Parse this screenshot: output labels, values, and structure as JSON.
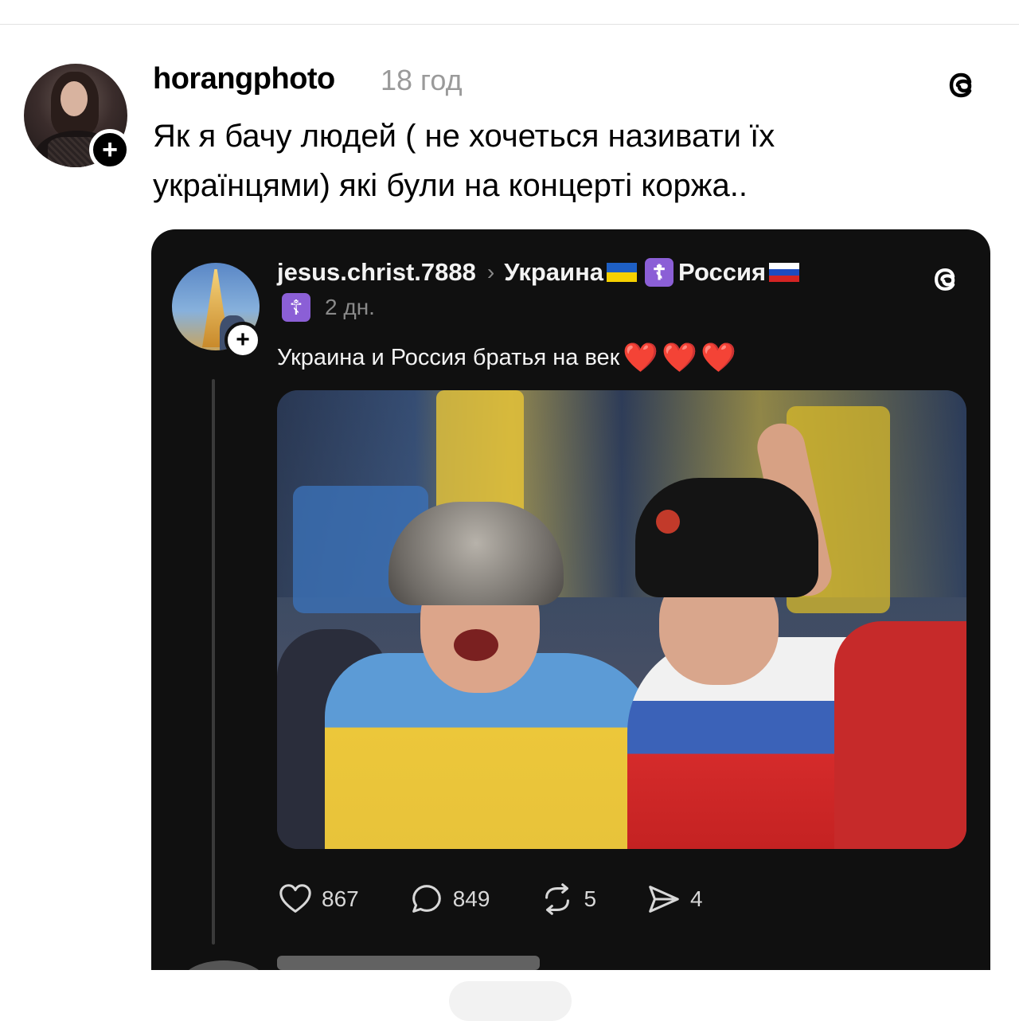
{
  "post": {
    "username": "horangphoto",
    "time": "18 год",
    "text": "Як я бачу людей ( не хочеться називати їх українцями) які були на концерті коржа..",
    "follow_symbol": "+",
    "logo_icon": "threads-logo-icon"
  },
  "embed": {
    "username": "jesus.christ.7888",
    "chevron": "›",
    "topic_part1": "Украина",
    "topic_part2": "Россия",
    "cross_symbol": "☦",
    "time": "2 дн.",
    "text": "Украина и Россия братья на век",
    "hearts": "❤️❤️❤️",
    "follow_symbol": "+",
    "colors": {
      "ua_blue": "#1e5fc4",
      "ua_yellow": "#f5d000",
      "ru_red": "#d32424",
      "badge_purple": "#8b5fd6"
    },
    "actions": {
      "likes": "867",
      "replies": "849",
      "reposts": "5",
      "shares": "4"
    }
  }
}
